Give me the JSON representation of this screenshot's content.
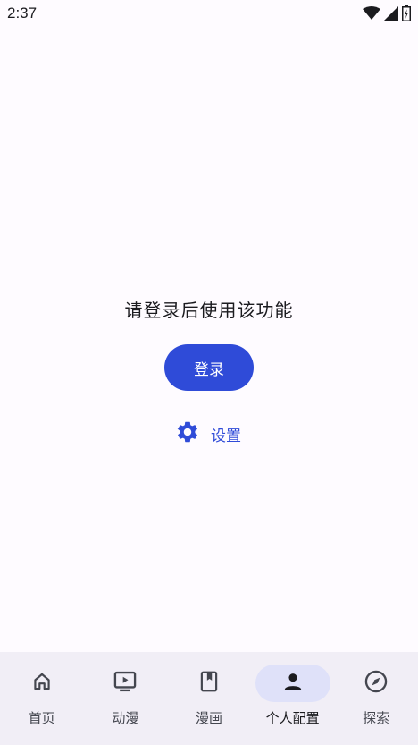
{
  "status_bar": {
    "time": "2:37",
    "icons": [
      "wifi-icon",
      "signal-icon",
      "battery-icon"
    ]
  },
  "main": {
    "prompt": "请登录后使用该功能",
    "login_button_label": "登录",
    "settings_label": "设置",
    "settings_icon": "gear-icon"
  },
  "bottom_nav": {
    "items": [
      {
        "label": "首页",
        "icon": "home-icon"
      },
      {
        "label": "动漫",
        "icon": "tv-play-icon"
      },
      {
        "label": "漫画",
        "icon": "book-icon"
      },
      {
        "label": "个人配置",
        "icon": "person-icon",
        "active": true
      },
      {
        "label": "探索",
        "icon": "compass-icon"
      }
    ]
  },
  "colors": {
    "accent": "#2f4bd8",
    "background": "#fefbff",
    "nav_background": "#f1eef6",
    "active_pill": "#dfe1f9"
  }
}
